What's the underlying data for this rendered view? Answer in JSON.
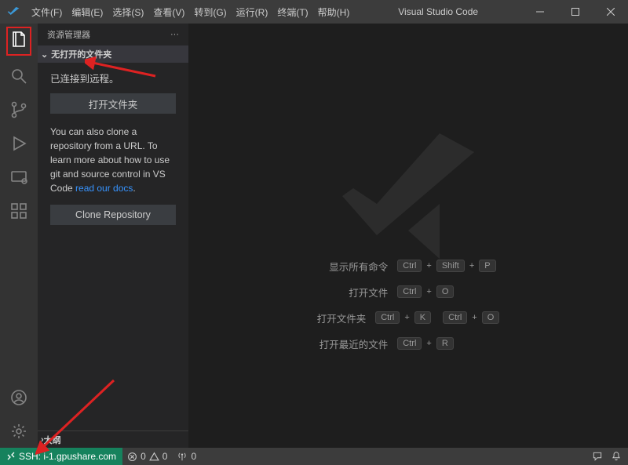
{
  "titlebar": {
    "menus": [
      "文件(F)",
      "编辑(E)",
      "选择(S)",
      "查看(V)",
      "转到(G)",
      "运行(R)",
      "终端(T)",
      "帮助(H)"
    ],
    "title": "Visual Studio Code"
  },
  "sidebar": {
    "title": "资源管理器",
    "section": "无打开的文件夹",
    "connected": "已连接到远程。",
    "openFolderBtn": "打开文件夹",
    "cloneDesc1": "You can also clone a repository from a URL. To learn more about how to use git and source control in VS Code ",
    "cloneLink": "read our docs",
    "cloneDesc2": ".",
    "cloneBtn": "Clone Repository",
    "outline": "大纲"
  },
  "commands": [
    {
      "label": "显示所有命令",
      "keys": [
        "Ctrl",
        "Shift",
        "P"
      ]
    },
    {
      "label": "打开文件",
      "keys": [
        "Ctrl",
        "O"
      ]
    },
    {
      "label": "打开文件夹",
      "keys": [
        "Ctrl",
        "K",
        "Ctrl",
        "O"
      ]
    },
    {
      "label": "打开最近的文件",
      "keys": [
        "Ctrl",
        "R"
      ]
    }
  ],
  "statusbar": {
    "remote": "SSH: i-1.gpushare.com",
    "errors": "0",
    "warnings": "0",
    "ports": "0"
  }
}
